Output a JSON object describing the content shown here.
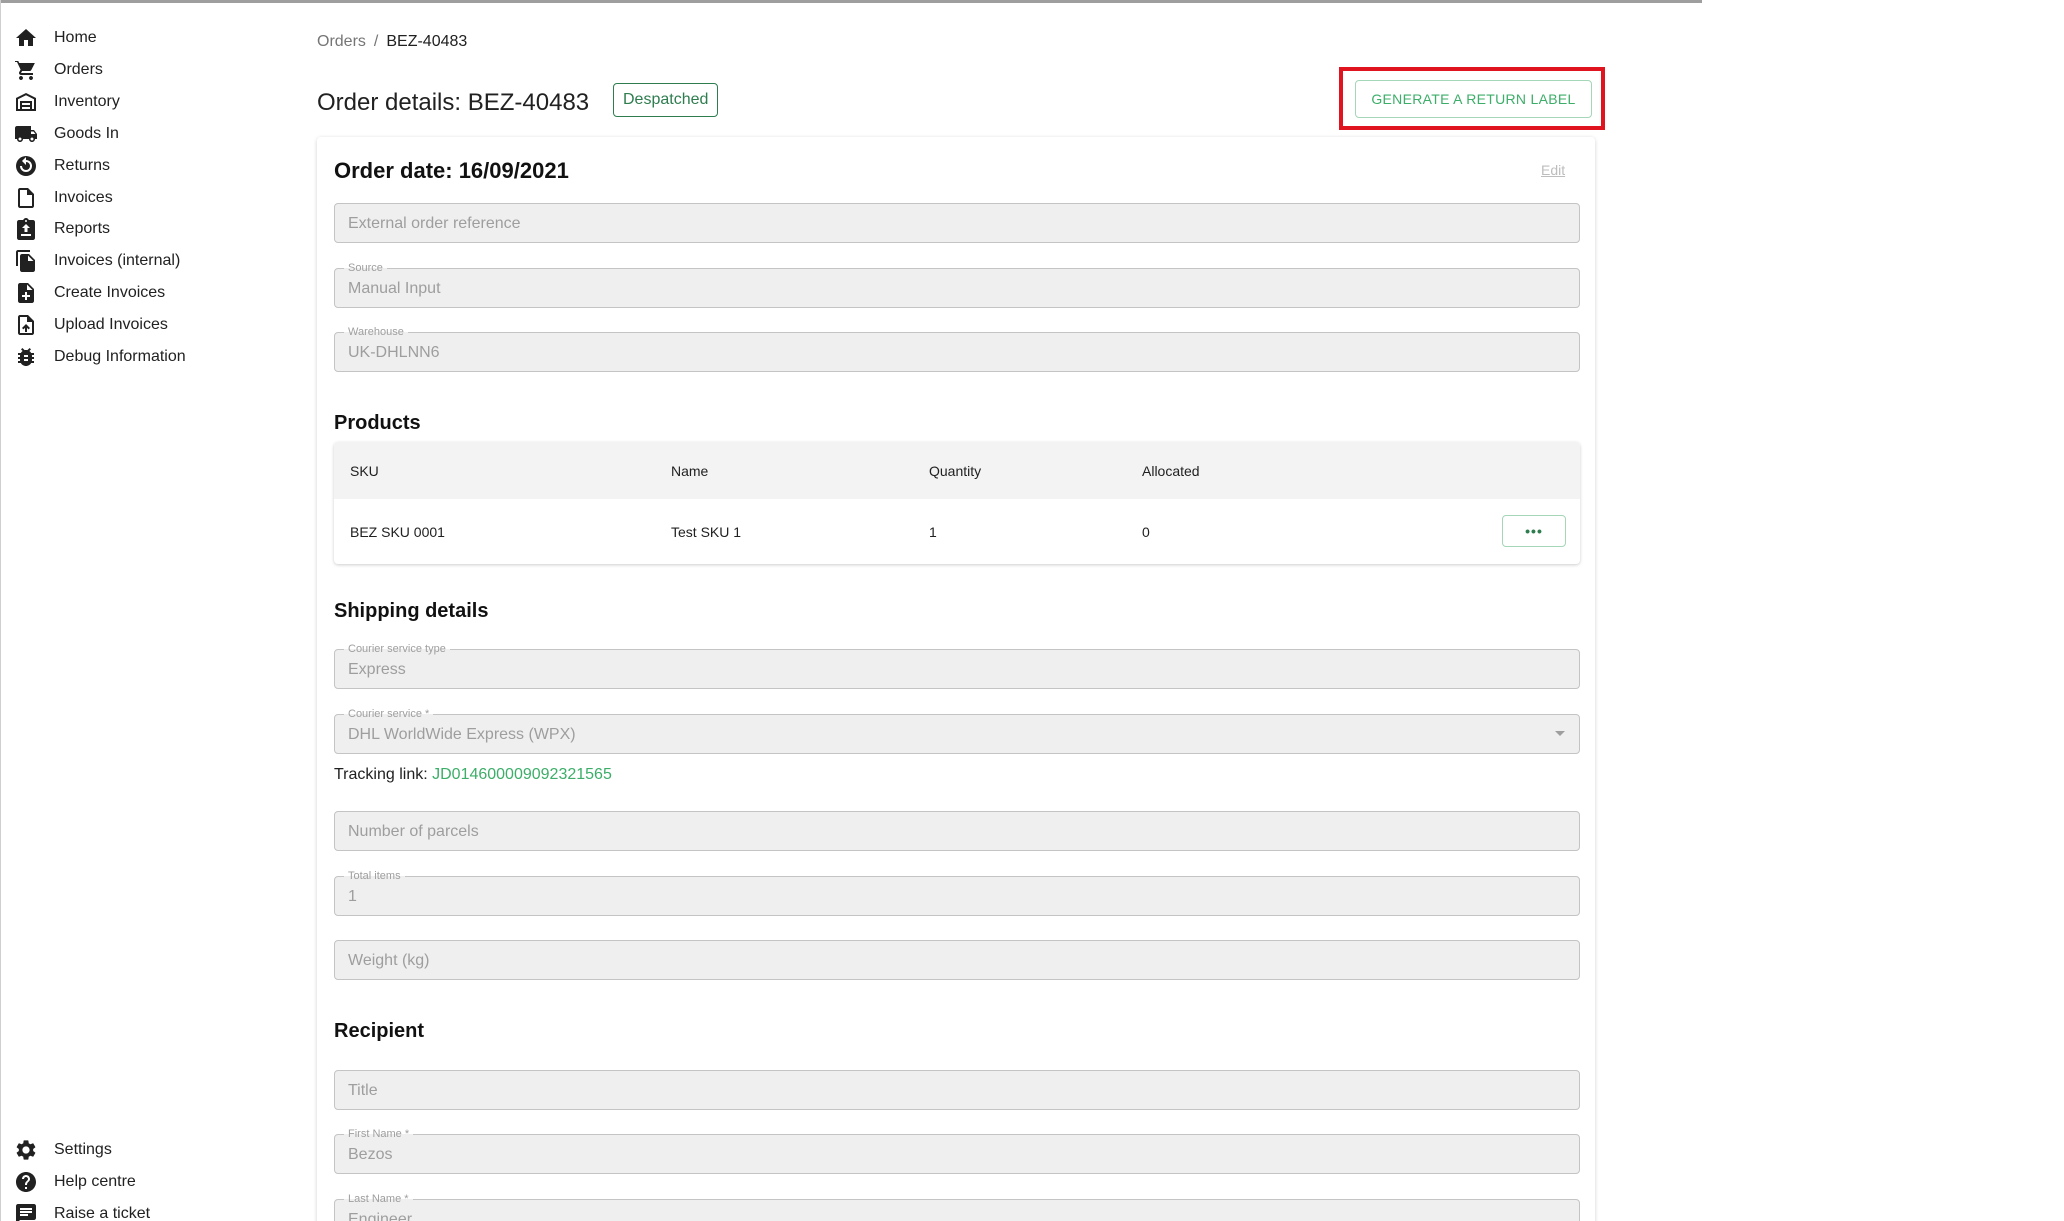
{
  "sidebar": {
    "items": [
      {
        "label": "Home",
        "icon": "home-icon"
      },
      {
        "label": "Orders",
        "icon": "cart-icon"
      },
      {
        "label": "Inventory",
        "icon": "warehouse-icon"
      },
      {
        "label": "Goods In",
        "icon": "truck-icon"
      },
      {
        "label": "Returns",
        "icon": "return-icon"
      },
      {
        "label": "Invoices",
        "icon": "document-icon"
      },
      {
        "label": "Reports",
        "icon": "report-icon"
      },
      {
        "label": "Invoices (internal)",
        "icon": "documents-icon"
      },
      {
        "label": "Create Invoices",
        "icon": "document-add-icon"
      },
      {
        "label": "Upload Invoices",
        "icon": "document-upload-icon"
      },
      {
        "label": "Debug Information",
        "icon": "bug-icon"
      }
    ],
    "bottom_items": [
      {
        "label": "Settings",
        "icon": "gear-icon"
      },
      {
        "label": "Help centre",
        "icon": "help-icon"
      },
      {
        "label": "Raise a ticket",
        "icon": "message-icon"
      }
    ]
  },
  "breadcrumb": {
    "parent": "Orders",
    "separator": "/",
    "current": "BEZ-40483"
  },
  "header": {
    "title": "Order details: BEZ-40483",
    "status": "Despatched",
    "return_label_button": "GENERATE A RETURN LABEL"
  },
  "order": {
    "date_label": "Order date: 16/09/2021",
    "edit_label": "Edit",
    "external_reference": {
      "placeholder": "External order reference"
    },
    "source": {
      "label": "Source",
      "value": "Manual Input"
    },
    "warehouse": {
      "label": "Warehouse",
      "value": "UK-DHLNN6"
    }
  },
  "products": {
    "title": "Products",
    "columns": [
      "SKU",
      "Name",
      "Quantity",
      "Allocated"
    ],
    "rows": [
      {
        "sku": "BEZ SKU 0001",
        "name": "Test SKU 1",
        "quantity": "1",
        "allocated": "0",
        "action": "•••"
      }
    ]
  },
  "shipping": {
    "title": "Shipping details",
    "courier_service_type": {
      "label": "Courier service type",
      "value": "Express"
    },
    "courier_service": {
      "label": "Courier service *",
      "value": "DHL WorldWide Express (WPX)"
    },
    "tracking_label": "Tracking link: ",
    "tracking_value": "JD014600009092321565",
    "parcels": {
      "placeholder": "Number of parcels"
    },
    "total_items": {
      "label": "Total items",
      "value": "1"
    },
    "weight": {
      "placeholder": "Weight (kg)"
    }
  },
  "recipient": {
    "title": "Recipient",
    "title_field": {
      "placeholder": "Title"
    },
    "first_name": {
      "label": "First Name *",
      "value": "Bezos"
    },
    "last_name": {
      "label": "Last Name *",
      "value": "Engineer"
    }
  },
  "colors": {
    "accent": "#3cae69",
    "badge": "#2e7d4f",
    "highlight": "#e0141e"
  }
}
